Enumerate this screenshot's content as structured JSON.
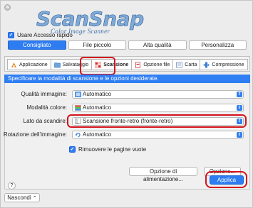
{
  "logo": {
    "main": "ScanSnap",
    "sub": "Color Image Scanner"
  },
  "quick_access": {
    "label": "Usare Accesso rapido",
    "checked": true
  },
  "profiles": [
    {
      "label": "Consigliato",
      "active": true
    },
    {
      "label": "File piccolo",
      "active": false
    },
    {
      "label": "Alta qualità",
      "active": false
    },
    {
      "label": "Personalizza",
      "active": false
    }
  ],
  "tabs": [
    {
      "label": "Applicazione",
      "icon": "application-icon"
    },
    {
      "label": "Salvataggio",
      "icon": "save-icon"
    },
    {
      "label": "Scansione",
      "icon": "scan-icon",
      "active": true
    },
    {
      "label": "Opzione file",
      "icon": "file-option-icon"
    },
    {
      "label": "Carta",
      "icon": "paper-icon"
    },
    {
      "label": "Compressione",
      "icon": "compression-icon"
    }
  ],
  "instruction": "Specificare la modalità di scansione e le opzioni desiderate.",
  "settings": {
    "quality_label": "Qualità immagine:",
    "quality_value": "Automatico",
    "color_label": "Modalità colore:",
    "color_value": "Automatico",
    "side_label": "Lato da scandire:",
    "side_value": "Scansione fronte-retro (fronte-retro)",
    "rotation_label": "Rotazione dell'immagine:",
    "rotation_value": "Automatico"
  },
  "remove_blank": {
    "label": "Rimuovere le pagine vuote",
    "checked": true
  },
  "buttons": {
    "feed_option": "Opzione di alimentazione...",
    "option": "Opzione...",
    "help": "?",
    "hide": "Nascondi",
    "apply": "Applica"
  },
  "colors": {
    "accent": "#2f7ef3",
    "highlight": "#d4131b"
  }
}
